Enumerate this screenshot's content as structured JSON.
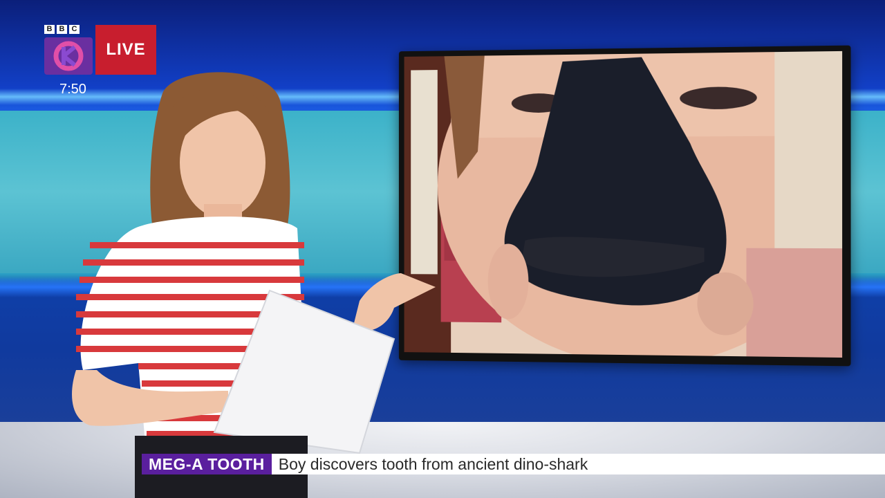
{
  "branding": {
    "network_letters": [
      "B",
      "B",
      "C"
    ],
    "channel_icon": "cbbc-logo-icon",
    "live_label": "LIVE"
  },
  "clock": {
    "time": "7:50"
  },
  "ticker": {
    "tag": "MEG-A TOOTH",
    "headline": "Boy discovers tooth from ancient dino-shark"
  },
  "colors": {
    "live_red": "#c81e2e",
    "ticker_purple": "#5a1f9e",
    "channel_purple": "#6a2fa0",
    "studio_teal": "#3cb2c9"
  }
}
